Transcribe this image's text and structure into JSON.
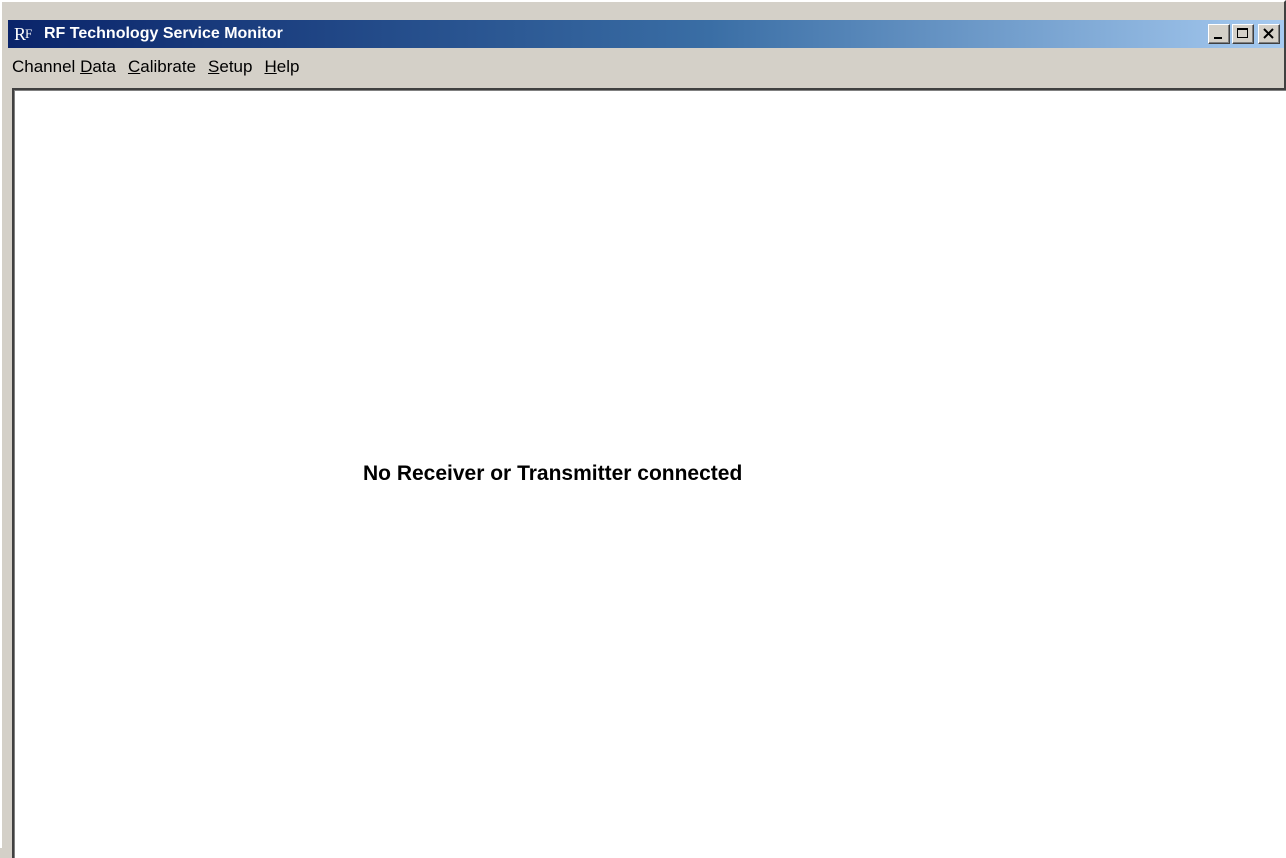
{
  "window": {
    "title": "RF Technology Service Monitor",
    "icon_text_big": "R",
    "icon_text_small": "F",
    "title_gradient_start": "#0a246a",
    "title_gradient_end": "#a6caf0"
  },
  "menu": {
    "items": [
      {
        "pre": "Channel ",
        "accel": "D",
        "post": "ata"
      },
      {
        "pre": "",
        "accel": "C",
        "post": "alibrate"
      },
      {
        "pre": "",
        "accel": "S",
        "post": "etup"
      },
      {
        "pre": "",
        "accel": "H",
        "post": "elp"
      }
    ]
  },
  "main": {
    "status_message": "No Receiver or Transmitter connected"
  }
}
